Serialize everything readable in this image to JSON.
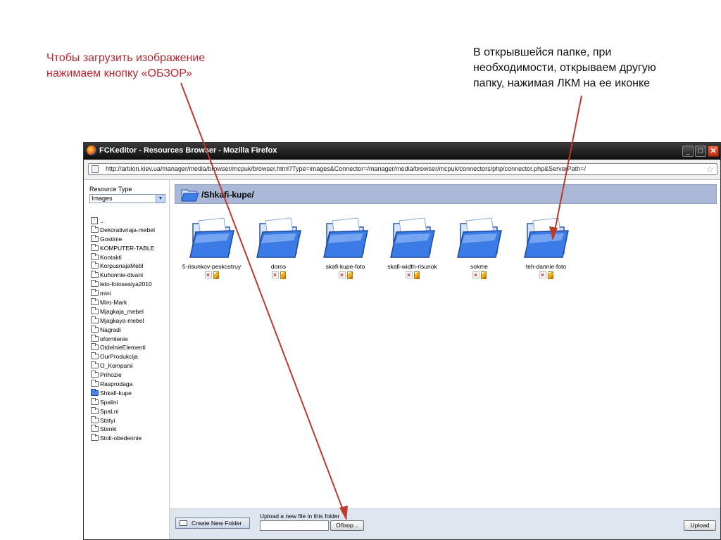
{
  "notes": {
    "left_lines": [
      "Чтобы загрузить изображение",
      "нажимаем кнопку «ОБЗОР»"
    ],
    "right_lines": [
      "В открывшейся папке, при",
      "необходимости, открываем другую",
      "папку, нажимая ЛКМ на ее иконке"
    ]
  },
  "window": {
    "title": "FCKeditor - Resources Browser - Mozilla Firefox",
    "url": "http://arbion.kiev.ua/manager/media/browser/mcpuk/browser.html?Type=images&Connector=/manager/media/browser/mcpuk/connectors/php/connector.php&ServerPath=/"
  },
  "resource_type": {
    "label": "Resource Type",
    "selected": "Images"
  },
  "tree": {
    "up": "..",
    "items": [
      "Dekorativnaja-mebel",
      "Gostinie",
      "KOMPUTER-TABLE",
      "Kontakti",
      "KorpusnajaMebl",
      "Kuhonnie-divani",
      "leto-fotosesiya2010",
      "mini",
      "Miro-Mark",
      "Mjagkaja_mebel",
      "Mjagkaya-mebel",
      "Nagradi",
      "oformlenie",
      "OtdelnieElementi",
      "OurProdukcija",
      "O_Kompanii",
      "Prihozie",
      "Rasprodaga",
      "Shkafi-kupe",
      "Spalini",
      "SpaLni",
      "Statyi",
      "Stenki",
      "Stoli-obedennie"
    ],
    "active": "Shkafi-kupe"
  },
  "current_path": "/Shkafi-kupe/",
  "folders": [
    "5-risunkov-peskostruy",
    "doros",
    "skafi-kupe-foto",
    "skafi-width-risunok",
    "sokme",
    "teh-dannie-foto"
  ],
  "bottom": {
    "create_folder": "Create New Folder",
    "upload_label": "Upload a new file in this folder",
    "browse": "Обзор...",
    "upload": "Upload"
  },
  "colors": {
    "note_red": "#c0262d",
    "arrow_red": "#c0392b",
    "folder_blue": "#2f6fe0",
    "header_bar": "#a9b8d6"
  }
}
